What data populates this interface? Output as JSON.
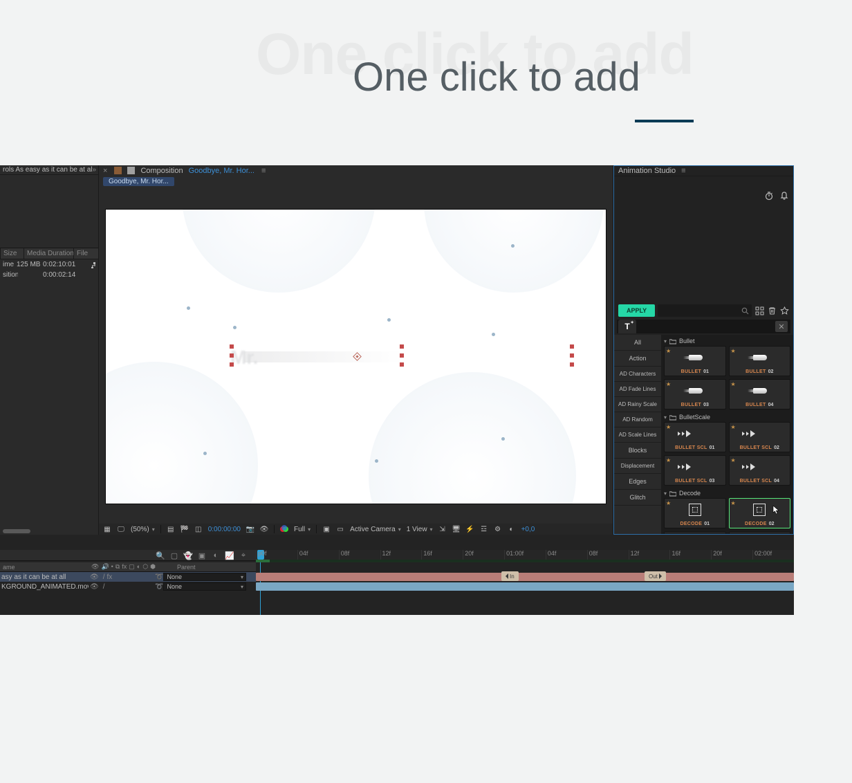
{
  "promo": {
    "ghost": "One click to add",
    "title": "One click to add"
  },
  "leftPanel": {
    "tab": "rols  As easy as it can be at al",
    "cols": {
      "size": "Size",
      "mediaDuration": "Media Duration",
      "file": "File"
    },
    "rows": [
      {
        "name": "ime",
        "size": "125 MB",
        "dur": "0:02:10:01"
      },
      {
        "name": "sition",
        "size": "",
        "dur": "0:00:02:14"
      }
    ]
  },
  "comp": {
    "panelLabel": "Composition",
    "name": "Goodbye, Mr. Hor...",
    "crumb": "Goodbye, Mr. Hor..."
  },
  "viewer": {
    "zoom": "(50%)",
    "time": "0:00:00:00",
    "res": "Full",
    "camera": "Active Camera",
    "views": "1 View",
    "exposure": "+0,0"
  },
  "studio": {
    "title": "Animation Studio",
    "apply": "APPLY",
    "categories": [
      "All",
      "Action",
      "AD Characters",
      "AD Fade Lines",
      "AD Rainy Scale",
      "AD Random",
      "AD Scale Lines",
      "Blocks",
      "Displacement",
      "Edges",
      "Glitch"
    ],
    "groups": [
      {
        "name": "Bullet",
        "presets": [
          {
            "n": "BULLET",
            "i": "01"
          },
          {
            "n": "BULLET",
            "i": "02"
          },
          {
            "n": "BULLET",
            "i": "03"
          },
          {
            "n": "BULLET",
            "i": "04"
          }
        ]
      },
      {
        "name": "BulletScale",
        "presets": [
          {
            "n": "BULLET SCL",
            "i": "01"
          },
          {
            "n": "BULLET SCL",
            "i": "02"
          },
          {
            "n": "BULLET SCL",
            "i": "03"
          },
          {
            "n": "BULLET SCL",
            "i": "04"
          }
        ]
      },
      {
        "name": "Decode",
        "presets": [
          {
            "n": "DECODE",
            "i": "01"
          },
          {
            "n": "DECODE",
            "i": "02"
          }
        ]
      }
    ]
  },
  "timeline": {
    "ruler": [
      "p0f",
      "04f",
      "08f",
      "12f",
      "16f",
      "20f",
      "01:00f",
      "04f",
      "08f",
      "12f",
      "16f",
      "20f",
      "02:00f"
    ],
    "head": {
      "name": "ame",
      "parent": "Parent"
    },
    "layers": [
      {
        "name": "asy as it can be at all",
        "parent": "None"
      },
      {
        "name": "KGROUND_ANIMATED.mov",
        "parent": "None"
      }
    ],
    "markers": {
      "in": "In",
      "out": "Out"
    }
  }
}
